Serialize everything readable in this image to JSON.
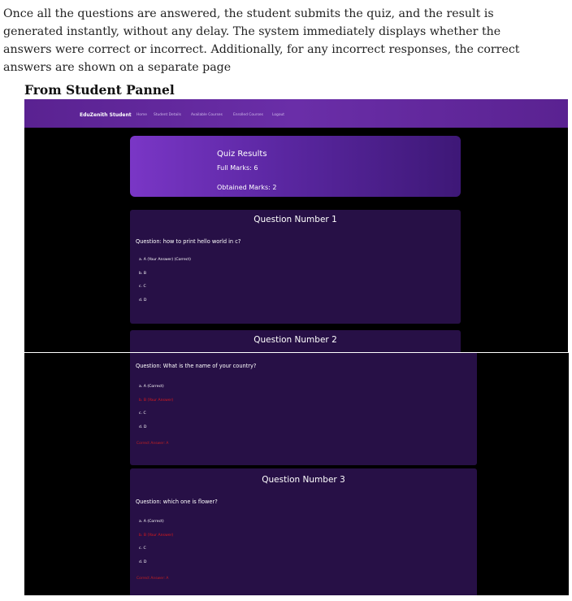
{
  "doc": {
    "lines": [
      "Once all the questions are answered, the student submits the quiz, and the result is",
      "generated instantly, without any delay. The system immediately displays whether the",
      "answers were correct or incorrect. Additionally, for any incorrect responses, the correct",
      "answers are shown on a separate page"
    ],
    "section_heading": "From Student Pannel"
  },
  "navbar": {
    "brand": "EduZenith Student",
    "links": [
      "Home",
      "Student Details",
      "Available Courses",
      "Enrolled Courses",
      "Logout"
    ]
  },
  "results": {
    "title": "Quiz Results",
    "full_marks": "Full Marks: 6",
    "obtained_marks": "Obtained Marks: 2"
  },
  "questions": [
    {
      "number_label": "Question Number 1",
      "question": "Question: how to print hello world in c?",
      "options": [
        "a.  A (Your Answer) (Correct)",
        "b.  B",
        "c.  C",
        "d.  D"
      ],
      "correct_note": ""
    },
    {
      "number_label": "Question Number 2",
      "question": "Question: What is the name of your country?",
      "options": [
        "a.  A (Correct)",
        "b.  B (Your Answer)",
        "c.  C",
        "d.  D"
      ],
      "correct_note": "Correct Answer: A"
    },
    {
      "number_label": "Question Number 3",
      "question": "Question: which one is flower?",
      "options": [
        "a.  A (Correct)",
        "b.  B (Your Answer)",
        "c.  C",
        "d.  D"
      ],
      "correct_note": "Correct Answer: A"
    }
  ],
  "colors": {
    "navbar": "#5a2291",
    "card_bg": "#271046",
    "results_gradient_start": "#7a36c6",
    "wrong_answer": "#e01a1a",
    "correct_note": "#c62020"
  }
}
